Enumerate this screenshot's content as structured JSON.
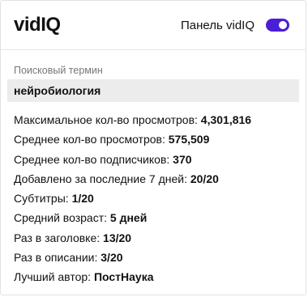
{
  "header": {
    "logo_vid": "vid",
    "logo_iq": "IQ",
    "toggle_label": "Панель vidIQ",
    "toggle_on": true,
    "accent_color": "#4a1fd6"
  },
  "search": {
    "section_label": "Поисковый термин",
    "term": "нейробиология"
  },
  "stats": [
    {
      "label": "Максимальное кол-во просмотров:",
      "value": "4,301,816"
    },
    {
      "label": "Среднее кол-во просмотров:",
      "value": "575,509"
    },
    {
      "label": "Среднее кол-во подписчиков:",
      "value": "370"
    },
    {
      "label": "Добавлено за последние 7 дней:",
      "value": "20/20"
    },
    {
      "label": "Субтитры:",
      "value": "1/20"
    },
    {
      "label": "Средний возраст:",
      "value": "5 дней"
    },
    {
      "label": "Раз в заголовке:",
      "value": "13/20"
    },
    {
      "label": "Раз в описании:",
      "value": "3/20"
    },
    {
      "label": "Лучший автор:",
      "value": "ПостНаука"
    }
  ]
}
